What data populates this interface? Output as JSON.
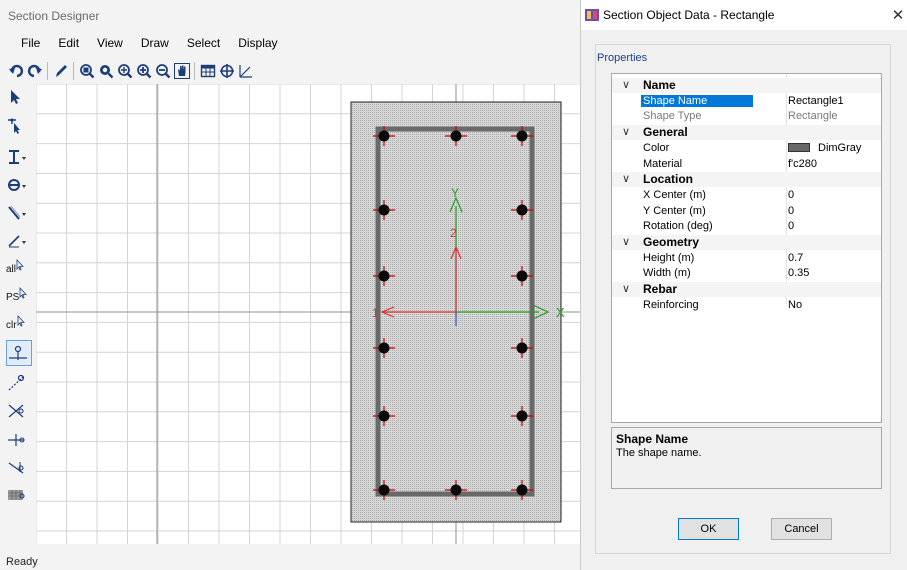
{
  "app": {
    "title": "Section Designer",
    "menu": [
      "File",
      "Edit",
      "View",
      "Draw",
      "Select",
      "Display"
    ],
    "status": "Ready",
    "left_tools": {
      "all_label": "all",
      "ps_label": "PS",
      "clr_label": "clr"
    }
  },
  "canvas": {
    "axis_x_label": "X",
    "axis_y_label": "Y",
    "local_axis_1": "1",
    "local_axis_2": "2",
    "section_color": "#696969",
    "rebar_color": "#cc0000"
  },
  "dialog": {
    "title": "Section Object Data - Rectangle",
    "close_glyph": "✕",
    "group_label": "Properties",
    "rows": [
      {
        "type": "cat",
        "k": "Name",
        "v": ""
      },
      {
        "type": "sel",
        "k": "Shape Name",
        "v": "Rectangle1"
      },
      {
        "type": "gray",
        "k": "Shape Type",
        "v": "Rectangle"
      },
      {
        "type": "cat",
        "k": "General",
        "v": ""
      },
      {
        "type": "swatch",
        "k": "Color",
        "v": "DimGray"
      },
      {
        "type": "prop",
        "k": "Material",
        "v": "f'c280"
      },
      {
        "type": "cat",
        "k": "Location",
        "v": ""
      },
      {
        "type": "prop",
        "k": "X Center (m)",
        "v": "0"
      },
      {
        "type": "prop",
        "k": "Y Center (m)",
        "v": "0"
      },
      {
        "type": "prop",
        "k": "Rotation (deg)",
        "v": "0"
      },
      {
        "type": "cat",
        "k": "Geometry",
        "v": ""
      },
      {
        "type": "prop",
        "k": "Height (m)",
        "v": "0.7"
      },
      {
        "type": "prop",
        "k": "Width (m)",
        "v": "0.35"
      },
      {
        "type": "cat",
        "k": "Rebar",
        "v": ""
      },
      {
        "type": "prop",
        "k": "Reinforcing",
        "v": "No"
      }
    ],
    "description": {
      "title": "Shape Name",
      "body": "The shape name."
    },
    "ok_label": "OK",
    "cancel_label": "Cancel"
  }
}
